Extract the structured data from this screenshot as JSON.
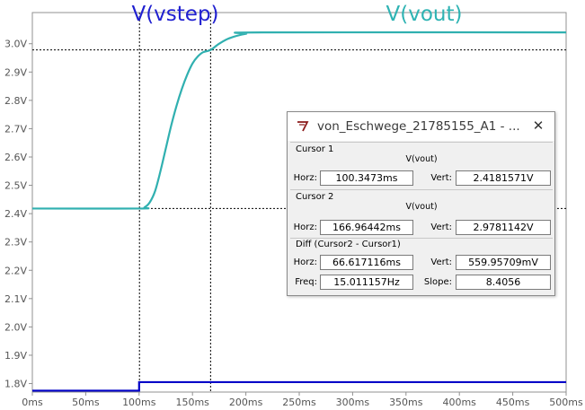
{
  "window": {
    "title": "von_Eschwege_21785155_A1 - ...",
    "close_glyph": "✕"
  },
  "plot": {
    "trace_titles": [
      {
        "label": "V(vstep)",
        "color": "#1f1fd0"
      },
      {
        "label": "V(vout)",
        "color": "#2eb3b3"
      }
    ],
    "colors": {
      "vout": "#30b0b0",
      "vstep": "#0000c8",
      "cursor_line": "#000000",
      "frame": "#909090"
    }
  },
  "chart_data": {
    "type": "line",
    "title": "",
    "xlabel": "",
    "ylabel": "",
    "xlim": [
      0,
      500
    ],
    "ylim": [
      1.77,
      3.11
    ],
    "x_ticks": [
      "0ms",
      "50ms",
      "100ms",
      "150ms",
      "200ms",
      "250ms",
      "300ms",
      "350ms",
      "400ms",
      "450ms",
      "500ms"
    ],
    "x_tick_values": [
      0,
      50,
      100,
      150,
      200,
      250,
      300,
      350,
      400,
      450,
      500
    ],
    "y_ticks": [
      "1.8V",
      "1.9V",
      "2.0V",
      "2.1V",
      "2.2V",
      "2.3V",
      "2.4V",
      "2.5V",
      "2.6V",
      "2.7V",
      "2.8V",
      "2.9V",
      "3.0V"
    ],
    "y_tick_values": [
      1.8,
      1.9,
      2.0,
      2.1,
      2.2,
      2.3,
      2.4,
      2.5,
      2.6,
      2.7,
      2.8,
      2.9,
      3.0
    ],
    "grid": false,
    "series": [
      {
        "name": "V(vout)",
        "x": [
          0,
          100,
          105,
          110,
          115,
          120,
          125,
          130,
          135,
          140,
          145,
          150,
          155,
          160,
          166.96,
          175,
          185,
          200,
          215,
          500
        ],
        "y": [
          2.418,
          2.418,
          2.422,
          2.44,
          2.48,
          2.55,
          2.63,
          2.71,
          2.78,
          2.84,
          2.89,
          2.93,
          2.955,
          2.97,
          2.978,
          3.0,
          3.02,
          3.035,
          3.04,
          3.04
        ]
      },
      {
        "name": "V(vstep)",
        "x": [
          0,
          100,
          100,
          500
        ],
        "y": [
          1.775,
          1.775,
          1.805,
          1.805
        ]
      }
    ],
    "cursors": [
      {
        "x": 100.3473,
        "y": 2.4181571
      },
      {
        "x": 166.96442,
        "y": 2.9781142
      }
    ]
  },
  "cursor1": {
    "label": "Cursor 1",
    "trace": "V(vout)",
    "horz_label": "Horz:",
    "horz_value": "100.3473ms",
    "vert_label": "Vert:",
    "vert_value": "2.4181571V"
  },
  "cursor2": {
    "label": "Cursor 2",
    "trace": "V(vout)",
    "horz_label": "Horz:",
    "horz_value": "166.96442ms",
    "vert_label": "Vert:",
    "vert_value": "2.9781142V"
  },
  "diff": {
    "label": "Diff (Cursor2 - Cursor1)",
    "horz_label": "Horz:",
    "horz_value": "66.617116ms",
    "vert_label": "Vert:",
    "vert_value": "559.95709mV",
    "freq_label": "Freq:",
    "freq_value": "15.011157Hz",
    "slope_label": "Slope:",
    "slope_value": "8.4056"
  }
}
